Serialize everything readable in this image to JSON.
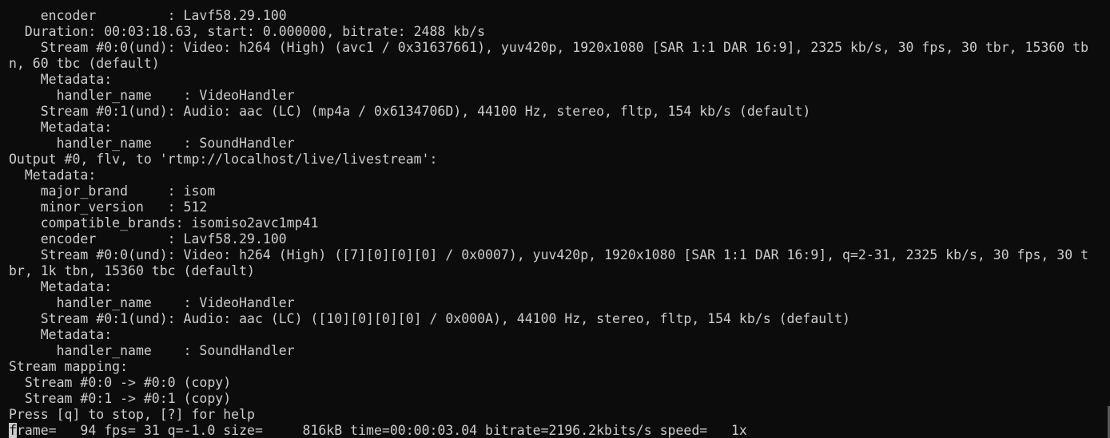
{
  "terminal": {
    "lines": [
      "    encoder         : Lavf58.29.100",
      "  Duration: 00:03:18.63, start: 0.000000, bitrate: 2488 kb/s",
      "    Stream #0:0(und): Video: h264 (High) (avc1 / 0x31637661), yuv420p, 1920x1080 [SAR 1:1 DAR 16:9], 2325 kb/s, 30 fps, 30 tbr, 15360 tb",
      "n, 60 tbc (default)",
      "    Metadata:",
      "      handler_name    : VideoHandler",
      "    Stream #0:1(und): Audio: aac (LC) (mp4a / 0x6134706D), 44100 Hz, stereo, fltp, 154 kb/s (default)",
      "    Metadata:",
      "      handler_name    : SoundHandler",
      "Output #0, flv, to 'rtmp://localhost/live/livestream':",
      "  Metadata:",
      "    major_brand     : isom",
      "    minor_version   : 512",
      "    compatible_brands: isomiso2avc1mp41",
      "    encoder         : Lavf58.29.100",
      "    Stream #0:0(und): Video: h264 (High) ([7][0][0][0] / 0x0007), yuv420p, 1920x1080 [SAR 1:1 DAR 16:9], q=2-31, 2325 kb/s, 30 fps, 30 t",
      "br, 1k tbn, 15360 tbc (default)",
      "    Metadata:",
      "      handler_name    : VideoHandler",
      "    Stream #0:1(und): Audio: aac (LC) ([10][0][0][0] / 0x000A), 44100 Hz, stereo, fltp, 154 kb/s (default)",
      "    Metadata:",
      "      handler_name    : SoundHandler",
      "Stream mapping:",
      "  Stream #0:0 -> #0:0 (copy)",
      "  Stream #0:1 -> #0:1 (copy)",
      "Press [q] to stop, [?] for help"
    ],
    "progress_cursor_char": "f",
    "progress_rest": "rame=   94 fps= 31 q=-1.0 size=     816kB time=00:00:03.04 bitrate=2196.2kbits/s speed=   1x"
  },
  "colors": {
    "background": "#0c0c0c",
    "foreground": "#cccccc",
    "scrollbar_thumb": "#5a5a5a"
  }
}
